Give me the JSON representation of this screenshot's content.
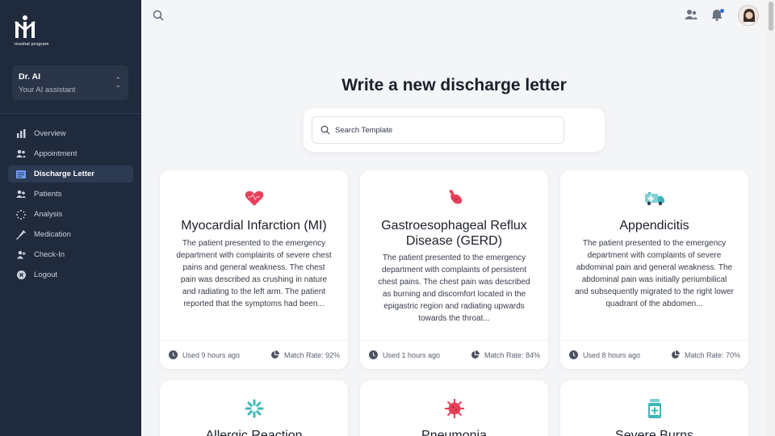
{
  "brand": {
    "logo_text": "moshal program"
  },
  "assistant": {
    "name": "Dr. AI",
    "subtitle": "Your AI assistant"
  },
  "nav": [
    {
      "label": "Overview",
      "icon": "bar-chart-icon",
      "active": false
    },
    {
      "label": "Appointment",
      "icon": "users-icon",
      "active": false
    },
    {
      "label": "Discharge Letter",
      "icon": "document-icon",
      "active": true
    },
    {
      "label": "Patients",
      "icon": "patients-icon",
      "active": false
    },
    {
      "label": "Analysis",
      "icon": "loader-icon",
      "active": false
    },
    {
      "label": "Medication",
      "icon": "syringe-icon",
      "active": false
    },
    {
      "label": "Check-In",
      "icon": "user-plus-icon",
      "active": false
    },
    {
      "label": "Logout",
      "icon": "close-circle-icon",
      "active": false
    }
  ],
  "page": {
    "title": "Write a new discharge letter"
  },
  "search": {
    "placeholder": "Search Template"
  },
  "cards": [
    {
      "icon": "heart-icon",
      "title": "Myocardial Infarction (MI)",
      "description": "The patient presented to the emergency department with complaints of severe chest pains and general weakness. The chest pain was described as crushing in nature and radiating to the left arm. The patient reported that the symptoms had been...",
      "used": "Used 9 hours ago",
      "match": "Match Rate: 92%"
    },
    {
      "icon": "stomach-icon",
      "title": "Gastroesophageal Reflux Disease (GERD)",
      "description": "The patient presented to the emergency department with complaints of persistent chest pains. The chest pain was described as burning and discomfort located in the epigastric region and radiating upwards towards the throat...",
      "used": "Used 1 hours ago",
      "match": "Match Rate: 84%"
    },
    {
      "icon": "ambulance-icon",
      "title": "Appendicitis",
      "description": "The patient presented to the emergency department with complaints of severe abdominal pain and general weakness. The abdominal pain was initially periumbilical and subsequently migrated to the right lower quadrant of the abdomen...",
      "used": "Used 8 hours ago",
      "match": "Match Rate: 70%"
    },
    {
      "icon": "allergy-icon",
      "title": "Allergic Reaction"
    },
    {
      "icon": "virus-icon",
      "title": "Pneumonia"
    },
    {
      "icon": "medicine-bottle-icon",
      "title": "Severe Burns"
    }
  ],
  "colors": {
    "sidebar_bg": "#1f2a3c",
    "heart": "#e8405a",
    "teal": "#3fb7b9",
    "accent": "#2d6cdf"
  }
}
